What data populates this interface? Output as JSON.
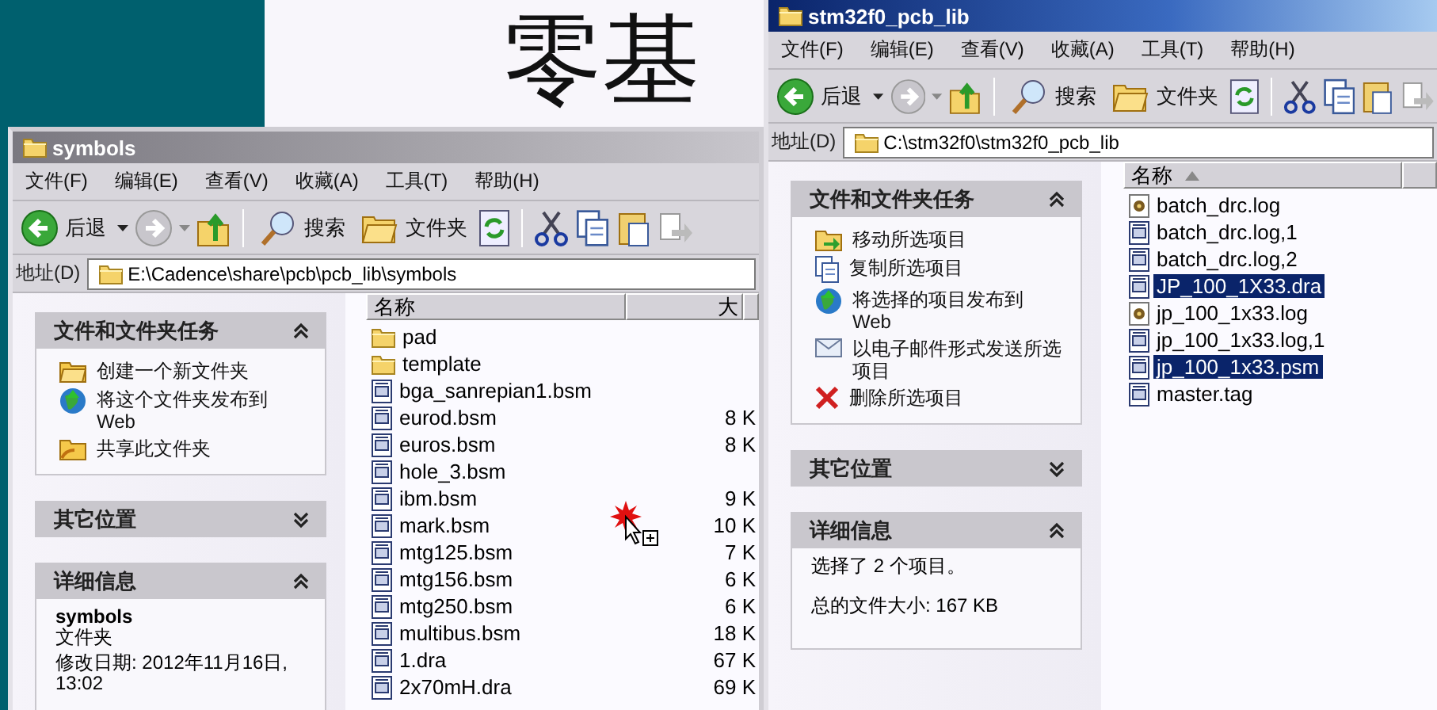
{
  "background": {
    "slide_text": "零基"
  },
  "windows": [
    {
      "title": "symbols",
      "active": false,
      "menu": [
        "文件(F)",
        "编辑(E)",
        "查看(V)",
        "收藏(A)",
        "工具(T)",
        "帮助(H)"
      ],
      "toolbar": {
        "back": "后退",
        "search": "搜索",
        "folders": "文件夹"
      },
      "address": {
        "label": "地址(D)",
        "value": "E:\\Cadence\\share\\pcb\\pcb_lib\\symbols"
      },
      "panels": [
        {
          "title": "文件和文件夹任务",
          "expanded": true,
          "items": [
            {
              "label": "创建一个新文件夹",
              "kind": "new-folder"
            },
            {
              "label": "将这个文件夹发布到 Web",
              "kind": "publish"
            },
            {
              "label": "共享此文件夹",
              "kind": "share"
            }
          ]
        },
        {
          "title": "其它位置",
          "expanded": false
        },
        {
          "title": "详细信息",
          "expanded": true,
          "lines": [
            {
              "text": "symbols",
              "kind": "name"
            },
            {
              "text": "文件夹",
              "kind": "type"
            },
            {
              "text": "修改日期: 2012年11月16日, 13:02",
              "kind": "info"
            }
          ]
        }
      ],
      "columns": [
        {
          "label": "名称",
          "sorted": false
        },
        {
          "label": "大",
          "sorted": false
        }
      ],
      "files": [
        {
          "name": "pad",
          "kind": "folder",
          "selected": false
        },
        {
          "name": "template",
          "kind": "folder",
          "selected": false
        },
        {
          "name": "bga_sanrepian1.bsm",
          "kind": "file",
          "selected": false
        },
        {
          "name": "eurod.bsm",
          "kind": "file",
          "size": "8 K",
          "selected": false
        },
        {
          "name": "euros.bsm",
          "kind": "file",
          "size": "8 K",
          "selected": false
        },
        {
          "name": "hole_3.bsm",
          "kind": "file",
          "selected": false
        },
        {
          "name": "ibm.bsm",
          "kind": "file",
          "size": "9 K",
          "selected": false
        },
        {
          "name": "mark.bsm",
          "kind": "file",
          "size": "10 K",
          "selected": false
        },
        {
          "name": "mtg125.bsm",
          "kind": "file",
          "size": "7 K",
          "selected": false
        },
        {
          "name": "mtg156.bsm",
          "kind": "file",
          "size": "6 K",
          "selected": false
        },
        {
          "name": "mtg250.bsm",
          "kind": "file",
          "size": "6 K",
          "selected": false
        },
        {
          "name": "multibus.bsm",
          "kind": "file",
          "size": "18 K",
          "selected": false
        },
        {
          "name": "1.dra",
          "kind": "file",
          "size": "67 K",
          "selected": false
        },
        {
          "name": "2x70mH.dra",
          "kind": "file",
          "size": "69 K",
          "selected": false
        }
      ]
    },
    {
      "title": "stm32f0_pcb_lib",
      "active": true,
      "menu": [
        "文件(F)",
        "编辑(E)",
        "查看(V)",
        "收藏(A)",
        "工具(T)",
        "帮助(H)"
      ],
      "toolbar": {
        "back": "后退",
        "search": "搜索",
        "folders": "文件夹"
      },
      "address": {
        "label": "地址(D)",
        "value": "C:\\stm32f0\\stm32f0_pcb_lib"
      },
      "panels": [
        {
          "title": "文件和文件夹任务",
          "expanded": true,
          "items": [
            {
              "label": "移动所选项目",
              "kind": "move"
            },
            {
              "label": "复制所选项目",
              "kind": "copy"
            },
            {
              "label": "将选择的项目发布到 Web",
              "kind": "publish"
            },
            {
              "label": "以电子邮件形式发送所选项目",
              "kind": "email"
            },
            {
              "label": "删除所选项目",
              "kind": "delete"
            }
          ]
        },
        {
          "title": "其它位置",
          "expanded": false
        },
        {
          "title": "详细信息",
          "expanded": true,
          "lines": [
            {
              "text": "选择了 2 个项目。",
              "kind": "info"
            },
            {
              "text": "总的文件大小: 167 KB",
              "kind": "info"
            }
          ]
        }
      ],
      "columns": [
        {
          "label": "名称",
          "sorted": true
        }
      ],
      "files": [
        {
          "name": "batch_drc.log",
          "kind": "log",
          "selected": false
        },
        {
          "name": "batch_drc.log,1",
          "kind": "file",
          "selected": false
        },
        {
          "name": "batch_drc.log,2",
          "kind": "file",
          "selected": false
        },
        {
          "name": "JP_100_1X33.dra",
          "kind": "file",
          "selected": true
        },
        {
          "name": "jp_100_1x33.log",
          "kind": "log",
          "selected": false
        },
        {
          "name": "jp_100_1x33.log,1",
          "kind": "file",
          "selected": false
        },
        {
          "name": "jp_100_1x33.psm",
          "kind": "file",
          "selected": true
        },
        {
          "name": "master.tag",
          "kind": "file",
          "selected": false
        }
      ]
    }
  ]
}
